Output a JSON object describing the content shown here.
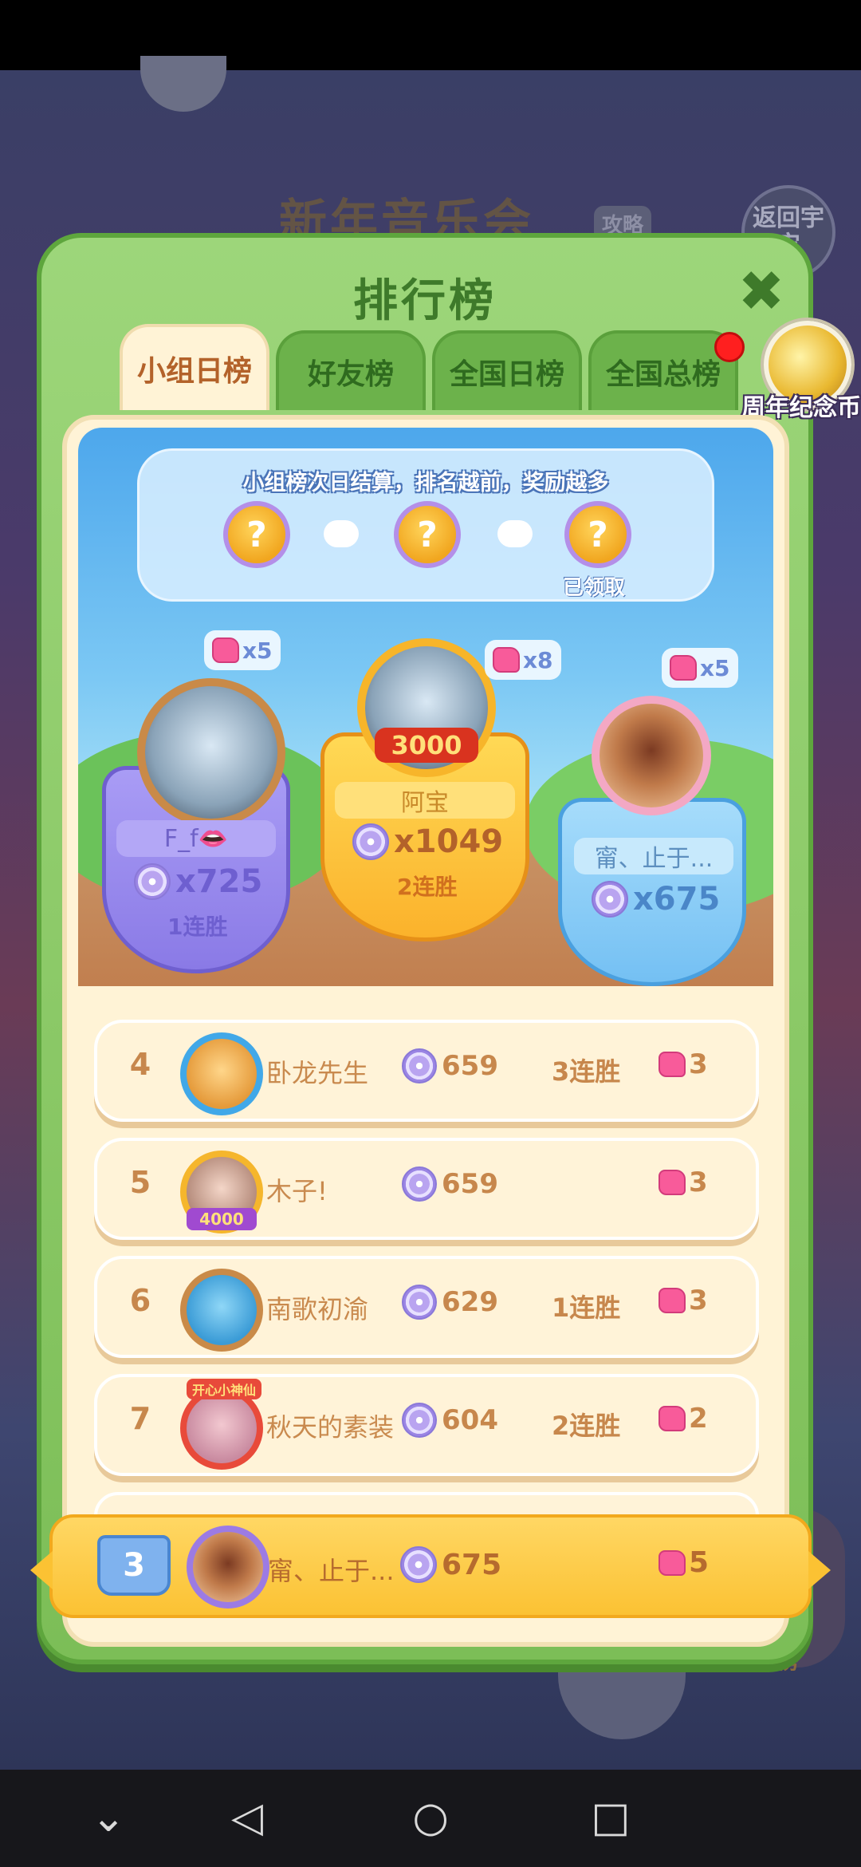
{
  "background": {
    "title": "新年音乐会",
    "guide_label": "攻略",
    "back_label": "返回宇宙",
    "corner_label": "蛋糕榜"
  },
  "panel": {
    "title": "排行榜",
    "close_icon": "close-icon",
    "tabs": [
      {
        "label": "小组日榜",
        "active": true
      },
      {
        "label": "好友榜",
        "active": false
      },
      {
        "label": "全国日榜",
        "active": false
      },
      {
        "label": "全国总榜",
        "active": false
      }
    ],
    "coin_label": "周年纪念币"
  },
  "banner": {
    "text": "小组榜次日结算，排名越前，奖励越多",
    "rewards": [
      "?",
      "?",
      "?"
    ],
    "claimed_label": "已领取"
  },
  "podium": {
    "first": {
      "badge": "3000",
      "name": "阿宝",
      "score": "x1049",
      "streak": "2连胜",
      "pieces": "x8"
    },
    "second": {
      "name": "F_f👄",
      "score": "x725",
      "streak": "1连胜",
      "pieces": "x5"
    },
    "third": {
      "name": "甯、止于...",
      "score": "x675",
      "pieces": "x5"
    }
  },
  "rows": [
    {
      "rank": "4",
      "name": "卧龙先生",
      "score": "659",
      "streak": "3连胜",
      "pieces": "3"
    },
    {
      "rank": "5",
      "name": "木子!",
      "score": "659",
      "streak": "",
      "pieces": "3",
      "avatar_badge": "4000"
    },
    {
      "rank": "6",
      "name": "南歌初渝",
      "score": "629",
      "streak": "1连胜",
      "pieces": "3"
    },
    {
      "rank": "7",
      "name": "秋天的素装",
      "score": "604",
      "streak": "2连胜",
      "pieces": "2",
      "avatar_badge": "开心小神仙"
    }
  ],
  "mine": {
    "rank": "3",
    "name": "甯、止于...",
    "score": "675",
    "pieces": "5"
  },
  "nav": {
    "back_icon": "back-icon",
    "home_icon": "home-icon",
    "recents_icon": "recents-icon",
    "collapse_icon": "chevron-down-icon"
  },
  "colors": {
    "panel_green": "#7cbe57",
    "tab_active": "#fff3d6",
    "gold": "#fbc233",
    "purple": "#8a7ae6",
    "blue": "#74c0f3"
  }
}
